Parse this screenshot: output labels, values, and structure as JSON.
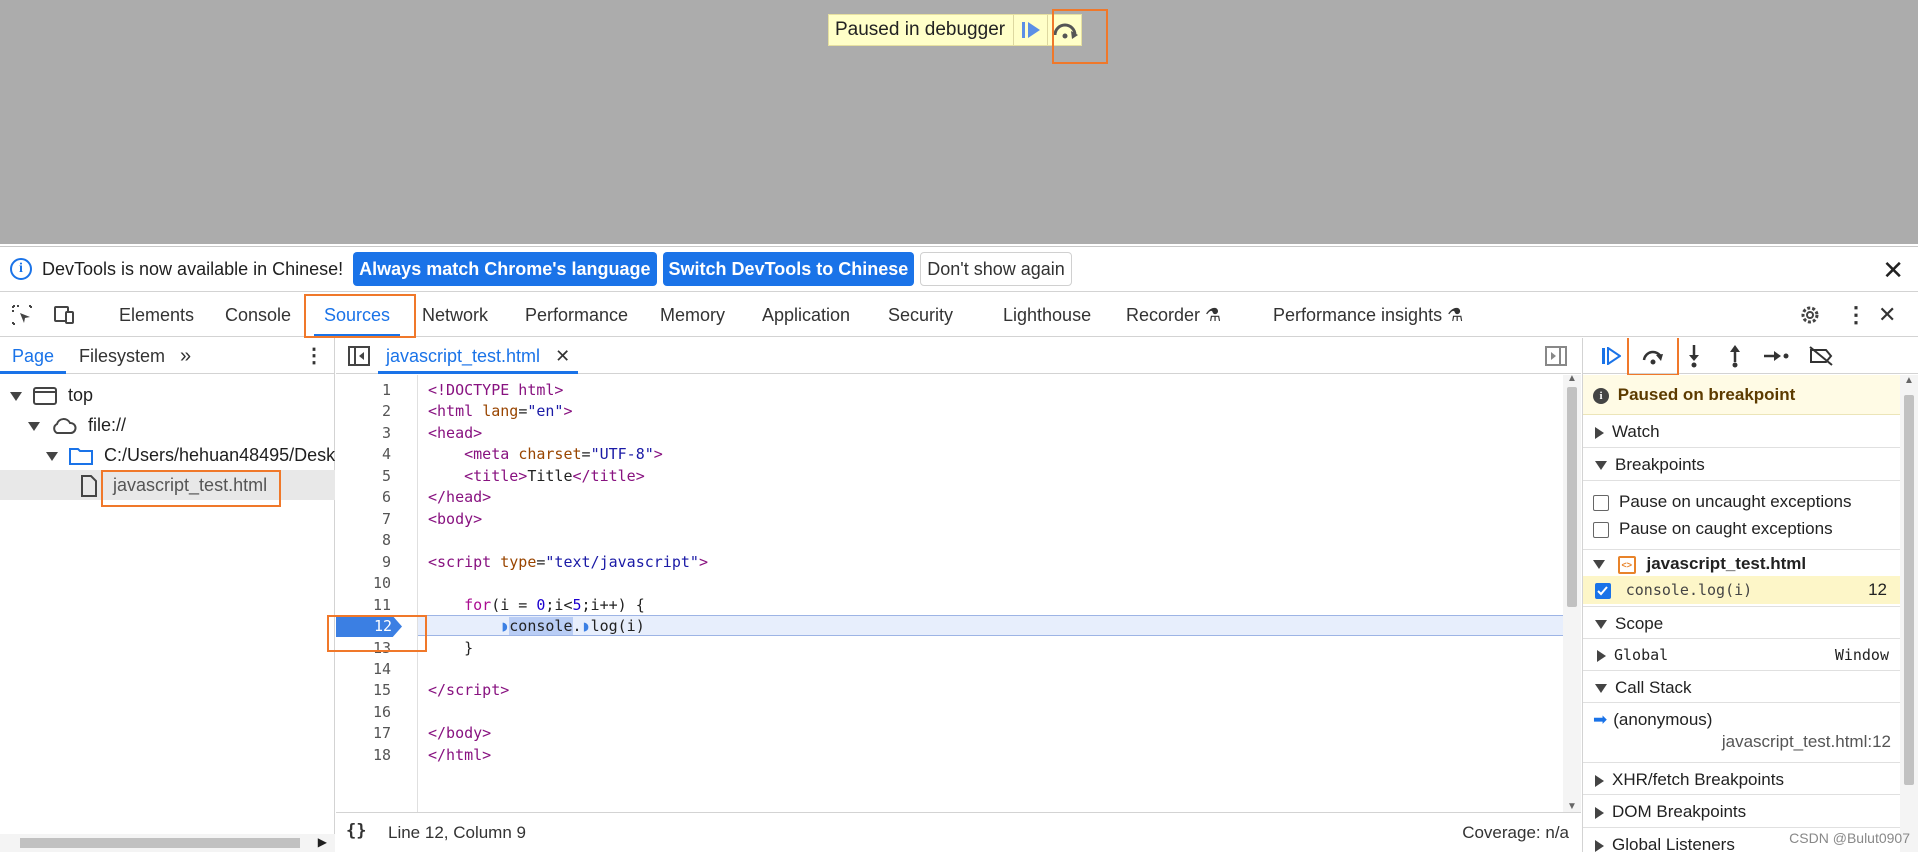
{
  "page": {
    "paused_banner_text": "Paused in debugger"
  },
  "infobar": {
    "message": "DevTools is now available in Chinese!",
    "btn_match": "Always match Chrome's language",
    "btn_switch": "Switch DevTools to Chinese",
    "btn_dismiss": "Don't show again"
  },
  "tabs": [
    "Elements",
    "Console",
    "Sources",
    "Network",
    "Performance",
    "Memory",
    "Application",
    "Security",
    "Lighthouse",
    "Recorder",
    "Performance insights"
  ],
  "active_tab": "Sources",
  "navigator": {
    "tabs": [
      "Page",
      "Filesystem"
    ],
    "tree": {
      "top": "top",
      "origin": "file://",
      "folder": "C:/Users/hehuan48495/Deskto",
      "file": "javascript_test.html"
    }
  },
  "editor": {
    "open_file": "javascript_test.html",
    "line_numbers": [
      "1",
      "2",
      "3",
      "4",
      "5",
      "6",
      "7",
      "8",
      "9",
      "10",
      "11",
      "12",
      "13",
      "14",
      "15",
      "16",
      "17",
      "18"
    ],
    "paused_line": "12",
    "status_position": "Line 12, Column 9",
    "coverage": "Coverage: n/a"
  },
  "debugger": {
    "paused_message": "Paused on breakpoint",
    "watch": "Watch",
    "breakpoints": "Breakpoints",
    "pause_uncaught": "Pause on uncaught exceptions",
    "pause_caught": "Pause on caught exceptions",
    "bp_file": "javascript_test.html",
    "bp_code": "console.log(i)",
    "bp_line": "12",
    "scope": "Scope",
    "scope_global": "Global",
    "scope_global_value": "Window",
    "call_stack": "Call Stack",
    "frame_name": "(anonymous)",
    "frame_location": "javascript_test.html:12",
    "xhr": "XHR/fetch Breakpoints",
    "dom": "DOM Breakpoints",
    "global_listeners": "Global Listeners"
  },
  "watermark": "CSDN @Bulut0907",
  "colors": {
    "accent": "#1a73e8",
    "highlight": "#f0782a",
    "paused_bg": "#ffffc8"
  }
}
